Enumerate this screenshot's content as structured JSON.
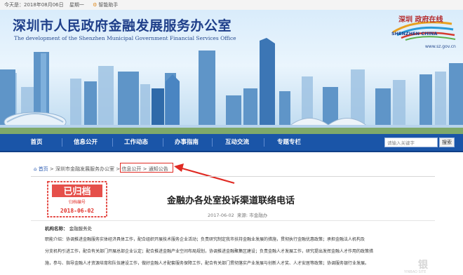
{
  "topbar": {
    "date": "今天是：2018年08月06日",
    "weekday": "星期一",
    "assistant": "智能助手"
  },
  "header": {
    "title_cn": "深圳市人民政府金融发展服务办公室",
    "title_en": "The development of the Shenzhen Municipal Government Financial Services Office",
    "logo_cn": "深圳 政府在线",
    "logo_en": "SHENZHEN CHINA",
    "url": "www.sz.gov.cn"
  },
  "nav": {
    "items": [
      {
        "label": "首页"
      },
      {
        "label": "信息公开"
      },
      {
        "label": "工作动态"
      },
      {
        "label": "办事指南"
      },
      {
        "label": "互动交流"
      },
      {
        "label": "专题专栏"
      }
    ],
    "search_placeholder": "请输入关键字",
    "search_button": "搜索"
  },
  "breadcrumb": {
    "home": "首页",
    "sep": ">",
    "items": [
      "深圳市金融发展服务办公室",
      "信息公开",
      "通知公告"
    ]
  },
  "stamp": {
    "text": "已归档",
    "sub": "归档编号",
    "date": "2018-06-02"
  },
  "article": {
    "title": "金融办各处室投诉渠道联络电话",
    "date": "2017-06-02",
    "source_label": "来源:",
    "source": "市金融办",
    "field_label": "机构名称：",
    "field_value": "金融服务处",
    "lines": [
      "职能介绍：协调推进金融服务实体经济具体工作，配合组织开展技术服务企业活动；负责研究制定我市扶持金融业发展的措施，贯彻执行金融优惠政策；承担金融法人机构及",
      "分支机构引进工作，配合有关部门开展总部企业认定；配合推进金融产业空间布局规划，协调推进金融聚集区建设；负责金融人才发展工作，研究提出发挥金融人才作用的政策措",
      "施，参与、指导金融人才资源培育和队伍建设工作，做好金融人才配套服务保障工作，配合有关部门贯彻落实产业发展与创新人才奖、人才安居等政策；协调服务银行业发展。"
    ]
  },
  "watermark": {
    "text": "银",
    "small": "YINBAO SITE"
  },
  "colors": {
    "nav_bg": "#1a55a8",
    "annotation_red": "#e02a23",
    "title_blue": "#1f3f8a"
  }
}
